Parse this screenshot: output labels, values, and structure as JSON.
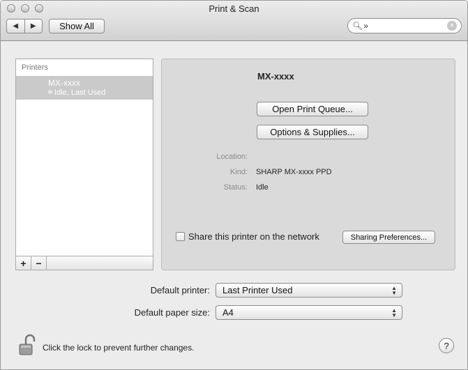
{
  "window": {
    "title": "Print & Scan"
  },
  "toolbar": {
    "back_icon": "triangle-left",
    "forward_icon": "triangle-right",
    "back_glyph": "◀",
    "forward_glyph": "▶",
    "show_all_label": "Show All",
    "search": {
      "value": "»",
      "icon": "magnifier"
    }
  },
  "printers": {
    "header": "Printers",
    "items": [
      {
        "name": "MX-xxxx",
        "status": "Idle, Last Used"
      }
    ],
    "add_label": "+",
    "remove_label": "−"
  },
  "detail": {
    "printer_name": "MX-xxxx",
    "open_queue_label": "Open Print Queue...",
    "options_supplies_label": "Options & Supplies...",
    "location_label": "Location:",
    "location_value": "",
    "kind_label": "Kind:",
    "kind_value": "SHARP MX-xxxx PPD",
    "status_label": "Status:",
    "status_value": "Idle",
    "share_label": "Share this printer on the network",
    "share_checked": false,
    "sharing_prefs_label": "Sharing Preferences..."
  },
  "defaults": {
    "printer_label": "Default printer:",
    "printer_value": "Last Printer Used",
    "paper_label": "Default paper size:",
    "paper_value": "A4"
  },
  "footer": {
    "lock_text": "Click the lock to prevent further changes.",
    "help_label": "?"
  }
}
